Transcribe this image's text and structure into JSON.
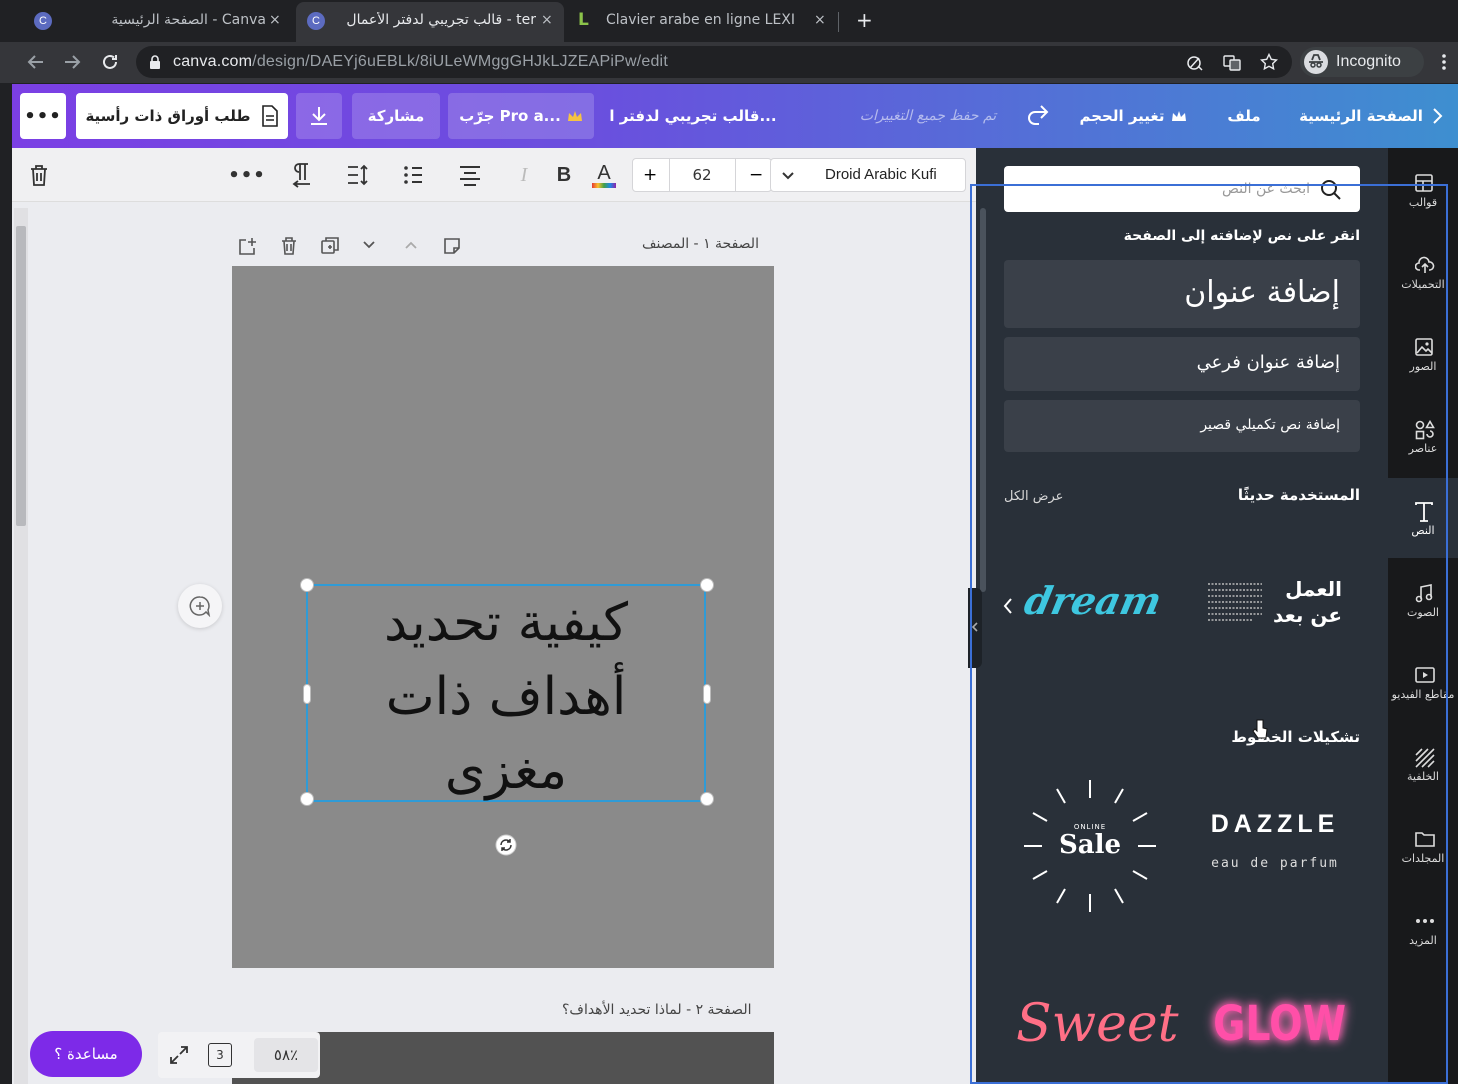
{
  "browser": {
    "tabs": [
      {
        "favicon": "C",
        "title": "الصفحة الرئيسية - Canva",
        "close": "×"
      },
      {
        "favicon": "C",
        "title": "قالب تجريبي لدفتر الأعمال - ter",
        "close": "×"
      },
      {
        "favicon": "L",
        "title": "Clavier arabe en ligne LEXI",
        "close": "×"
      }
    ],
    "new_tab": "+",
    "url_host": "canva.com",
    "url_path": "/design/DAEYj6uEBLk/8iULeWMggGHJkLJZEAPiPw/edit",
    "incognito_label": "Incognito"
  },
  "header": {
    "home": "الصفحة الرئيسية",
    "file": "ملف",
    "resize": "تغيير الحجم",
    "saved_status": "تم حفظ جميع التغييرات",
    "design_title": "قالب تجريبي لدفتر ا...",
    "try_pro": "جرّب Pro a...",
    "share": "مشاركة",
    "print": "طلب أوراق ذات رأسية",
    "more": "•••"
  },
  "toolbar": {
    "font_name": "Droid Arabic Kufi",
    "font_size": "62",
    "minus": "−",
    "plus": "+",
    "bold": "B",
    "italic": "I",
    "color_letter": "A",
    "more": "•••"
  },
  "canvas": {
    "page1_title": "الصفحة ١ - المصنف",
    "page2_title": "الصفحة ٢ - لماذا تحديد الأهداف؟",
    "text_line1": "كيفية تحديد",
    "text_line2": "أهداف ذات",
    "text_line3": "مغزى",
    "zoom": "٥٨٪",
    "page_count": "3",
    "help": "مساعدة ؟"
  },
  "sidenav": {
    "items": [
      {
        "label": "قوالب",
        "icon": "templates-icon"
      },
      {
        "label": "التحميلات",
        "icon": "uploads-icon"
      },
      {
        "label": "الصور",
        "icon": "photos-icon"
      },
      {
        "label": "عناصر",
        "icon": "elements-icon"
      },
      {
        "label": "النص",
        "icon": "text-icon"
      },
      {
        "label": "الصوت",
        "icon": "audio-icon"
      },
      {
        "label": "مقاطع الفيديو",
        "icon": "video-icon"
      },
      {
        "label": "الخلفية",
        "icon": "background-icon"
      },
      {
        "label": "المجلدات",
        "icon": "folders-icon"
      },
      {
        "label": "المزيد",
        "icon": "more-icon"
      }
    ]
  },
  "panel": {
    "search_placeholder": "ابحث عن النص",
    "click_hint": "انقر على نص لإضافته إلى الصفحة",
    "add_heading": "إضافة عنوان",
    "add_subheading": "إضافة عنوان فرعي",
    "add_body": "إضافة نص تكميلي قصير",
    "recent_title": "المستخدمة حديثًا",
    "see_all": "عرض الكل",
    "recent_1_line1": "العمل",
    "recent_1_line2": "عن بعد",
    "recent_2": "dream",
    "combos_title": "تشكيلات الخطوط",
    "combo_sale_small": "ONLINE",
    "combo_sale": "Sale",
    "combo_dazzle": "DAZZLE",
    "combo_dazzle_sub": "eau de parfum",
    "combo_sweet": "Sweet",
    "combo_glow": "GLOW"
  },
  "colors": {
    "panel_bg": "#293039",
    "header_start": "#7b3fe4",
    "header_end": "#3e8fd0",
    "selection": "#2f9bd6",
    "dream": "#3ec7e0",
    "sweet": "#ff6f86",
    "glow": "#ff4fa8"
  }
}
